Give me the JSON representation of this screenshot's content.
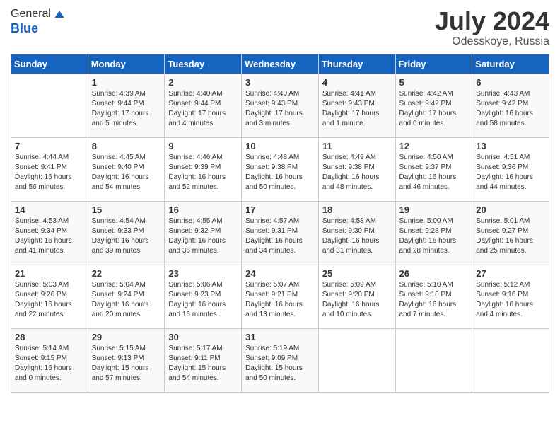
{
  "header": {
    "logo_general": "General",
    "logo_blue": "Blue",
    "month_year": "July 2024",
    "location": "Odesskoye, Russia"
  },
  "columns": [
    "Sunday",
    "Monday",
    "Tuesday",
    "Wednesday",
    "Thursday",
    "Friday",
    "Saturday"
  ],
  "weeks": [
    [
      {
        "day": "",
        "sunrise": "",
        "sunset": "",
        "daylight": ""
      },
      {
        "day": "1",
        "sunrise": "Sunrise: 4:39 AM",
        "sunset": "Sunset: 9:44 PM",
        "daylight": "Daylight: 17 hours and 5 minutes."
      },
      {
        "day": "2",
        "sunrise": "Sunrise: 4:40 AM",
        "sunset": "Sunset: 9:44 PM",
        "daylight": "Daylight: 17 hours and 4 minutes."
      },
      {
        "day": "3",
        "sunrise": "Sunrise: 4:40 AM",
        "sunset": "Sunset: 9:43 PM",
        "daylight": "Daylight: 17 hours and 3 minutes."
      },
      {
        "day": "4",
        "sunrise": "Sunrise: 4:41 AM",
        "sunset": "Sunset: 9:43 PM",
        "daylight": "Daylight: 17 hours and 1 minute."
      },
      {
        "day": "5",
        "sunrise": "Sunrise: 4:42 AM",
        "sunset": "Sunset: 9:42 PM",
        "daylight": "Daylight: 17 hours and 0 minutes."
      },
      {
        "day": "6",
        "sunrise": "Sunrise: 4:43 AM",
        "sunset": "Sunset: 9:42 PM",
        "daylight": "Daylight: 16 hours and 58 minutes."
      }
    ],
    [
      {
        "day": "7",
        "sunrise": "Sunrise: 4:44 AM",
        "sunset": "Sunset: 9:41 PM",
        "daylight": "Daylight: 16 hours and 56 minutes."
      },
      {
        "day": "8",
        "sunrise": "Sunrise: 4:45 AM",
        "sunset": "Sunset: 9:40 PM",
        "daylight": "Daylight: 16 hours and 54 minutes."
      },
      {
        "day": "9",
        "sunrise": "Sunrise: 4:46 AM",
        "sunset": "Sunset: 9:39 PM",
        "daylight": "Daylight: 16 hours and 52 minutes."
      },
      {
        "day": "10",
        "sunrise": "Sunrise: 4:48 AM",
        "sunset": "Sunset: 9:38 PM",
        "daylight": "Daylight: 16 hours and 50 minutes."
      },
      {
        "day": "11",
        "sunrise": "Sunrise: 4:49 AM",
        "sunset": "Sunset: 9:38 PM",
        "daylight": "Daylight: 16 hours and 48 minutes."
      },
      {
        "day": "12",
        "sunrise": "Sunrise: 4:50 AM",
        "sunset": "Sunset: 9:37 PM",
        "daylight": "Daylight: 16 hours and 46 minutes."
      },
      {
        "day": "13",
        "sunrise": "Sunrise: 4:51 AM",
        "sunset": "Sunset: 9:36 PM",
        "daylight": "Daylight: 16 hours and 44 minutes."
      }
    ],
    [
      {
        "day": "14",
        "sunrise": "Sunrise: 4:53 AM",
        "sunset": "Sunset: 9:34 PM",
        "daylight": "Daylight: 16 hours and 41 minutes."
      },
      {
        "day": "15",
        "sunrise": "Sunrise: 4:54 AM",
        "sunset": "Sunset: 9:33 PM",
        "daylight": "Daylight: 16 hours and 39 minutes."
      },
      {
        "day": "16",
        "sunrise": "Sunrise: 4:55 AM",
        "sunset": "Sunset: 9:32 PM",
        "daylight": "Daylight: 16 hours and 36 minutes."
      },
      {
        "day": "17",
        "sunrise": "Sunrise: 4:57 AM",
        "sunset": "Sunset: 9:31 PM",
        "daylight": "Daylight: 16 hours and 34 minutes."
      },
      {
        "day": "18",
        "sunrise": "Sunrise: 4:58 AM",
        "sunset": "Sunset: 9:30 PM",
        "daylight": "Daylight: 16 hours and 31 minutes."
      },
      {
        "day": "19",
        "sunrise": "Sunrise: 5:00 AM",
        "sunset": "Sunset: 9:28 PM",
        "daylight": "Daylight: 16 hours and 28 minutes."
      },
      {
        "day": "20",
        "sunrise": "Sunrise: 5:01 AM",
        "sunset": "Sunset: 9:27 PM",
        "daylight": "Daylight: 16 hours and 25 minutes."
      }
    ],
    [
      {
        "day": "21",
        "sunrise": "Sunrise: 5:03 AM",
        "sunset": "Sunset: 9:26 PM",
        "daylight": "Daylight: 16 hours and 22 minutes."
      },
      {
        "day": "22",
        "sunrise": "Sunrise: 5:04 AM",
        "sunset": "Sunset: 9:24 PM",
        "daylight": "Daylight: 16 hours and 20 minutes."
      },
      {
        "day": "23",
        "sunrise": "Sunrise: 5:06 AM",
        "sunset": "Sunset: 9:23 PM",
        "daylight": "Daylight: 16 hours and 16 minutes."
      },
      {
        "day": "24",
        "sunrise": "Sunrise: 5:07 AM",
        "sunset": "Sunset: 9:21 PM",
        "daylight": "Daylight: 16 hours and 13 minutes."
      },
      {
        "day": "25",
        "sunrise": "Sunrise: 5:09 AM",
        "sunset": "Sunset: 9:20 PM",
        "daylight": "Daylight: 16 hours and 10 minutes."
      },
      {
        "day": "26",
        "sunrise": "Sunrise: 5:10 AM",
        "sunset": "Sunset: 9:18 PM",
        "daylight": "Daylight: 16 hours and 7 minutes."
      },
      {
        "day": "27",
        "sunrise": "Sunrise: 5:12 AM",
        "sunset": "Sunset: 9:16 PM",
        "daylight": "Daylight: 16 hours and 4 minutes."
      }
    ],
    [
      {
        "day": "28",
        "sunrise": "Sunrise: 5:14 AM",
        "sunset": "Sunset: 9:15 PM",
        "daylight": "Daylight: 16 hours and 0 minutes."
      },
      {
        "day": "29",
        "sunrise": "Sunrise: 5:15 AM",
        "sunset": "Sunset: 9:13 PM",
        "daylight": "Daylight: 15 hours and 57 minutes."
      },
      {
        "day": "30",
        "sunrise": "Sunrise: 5:17 AM",
        "sunset": "Sunset: 9:11 PM",
        "daylight": "Daylight: 15 hours and 54 minutes."
      },
      {
        "day": "31",
        "sunrise": "Sunrise: 5:19 AM",
        "sunset": "Sunset: 9:09 PM",
        "daylight": "Daylight: 15 hours and 50 minutes."
      },
      {
        "day": "",
        "sunrise": "",
        "sunset": "",
        "daylight": ""
      },
      {
        "day": "",
        "sunrise": "",
        "sunset": "",
        "daylight": ""
      },
      {
        "day": "",
        "sunrise": "",
        "sunset": "",
        "daylight": ""
      }
    ]
  ]
}
